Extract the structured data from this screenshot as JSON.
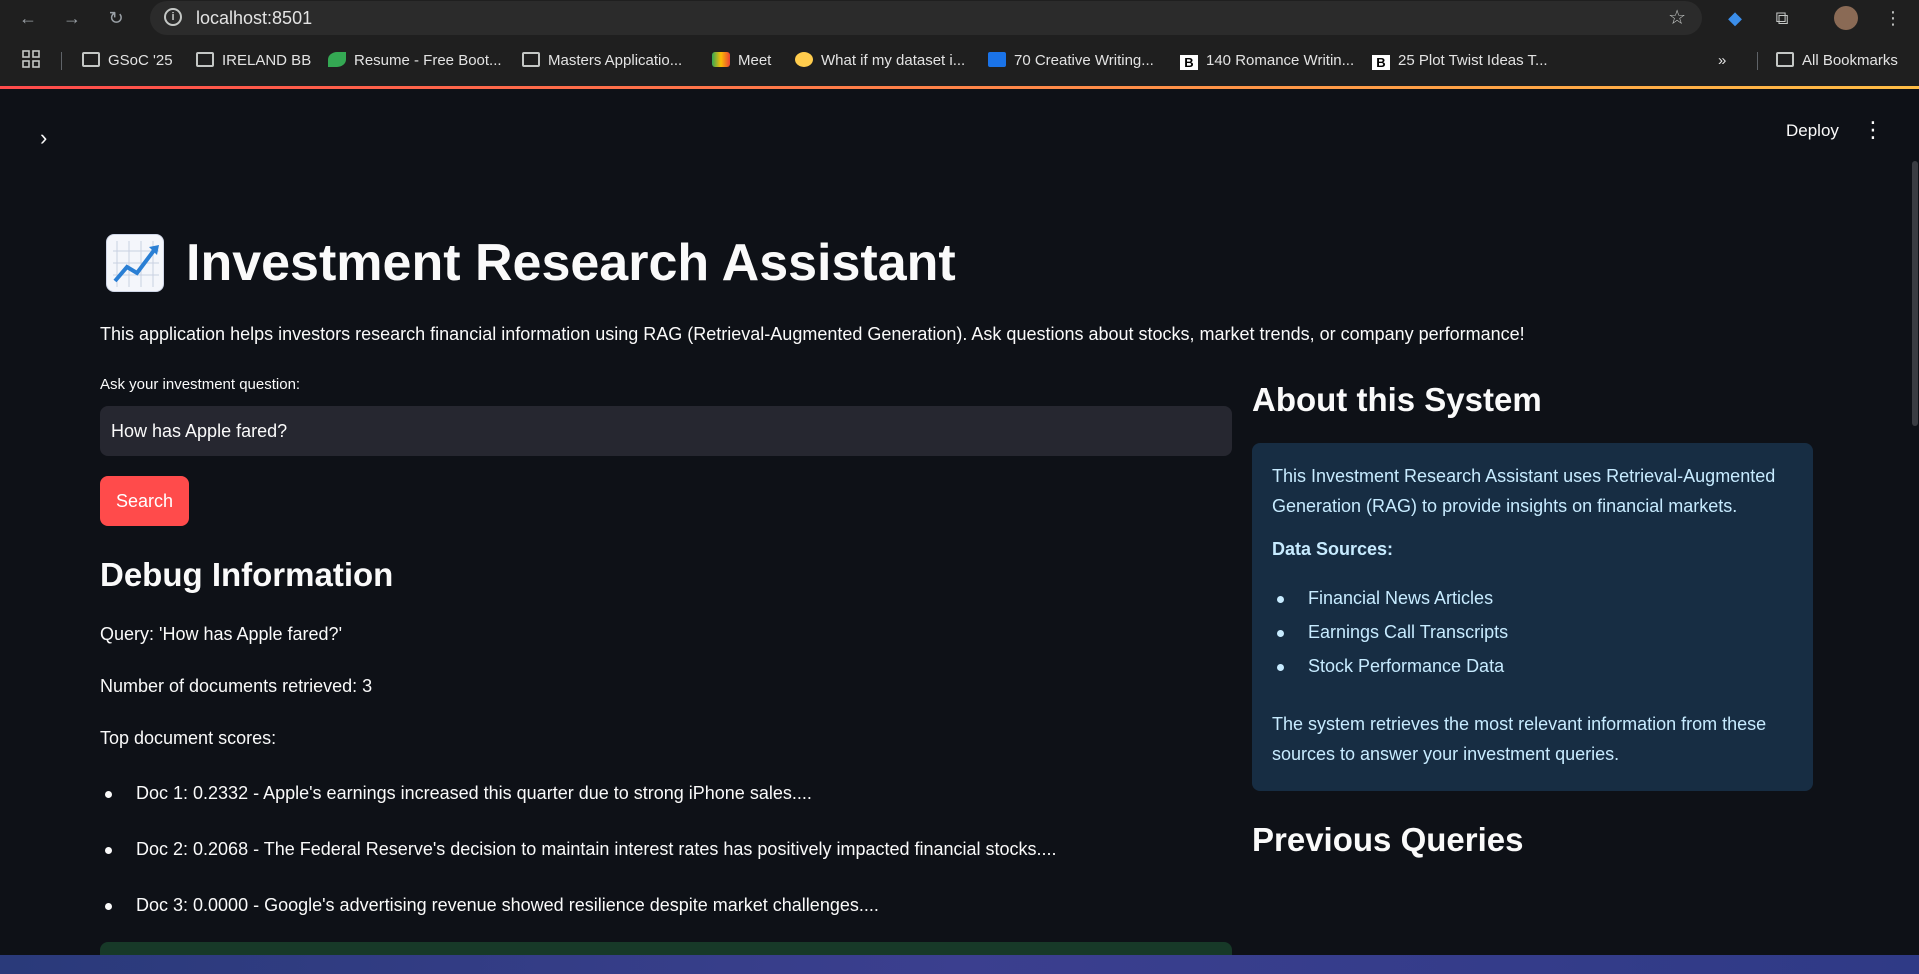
{
  "browser": {
    "url": "localhost:8501",
    "bookmarks": [
      {
        "label": "GSoC '25",
        "icon": "folder-icon"
      },
      {
        "label": "IRELAND BB",
        "icon": "folder-icon"
      },
      {
        "label": "Resume - Free Boot...",
        "icon": "leaf-icon"
      },
      {
        "label": "Masters Applicatio...",
        "icon": "folder-icon"
      },
      {
        "label": "Meet",
        "icon": "meet-icon"
      },
      {
        "label": "What if my dataset i...",
        "icon": "hugging-face-icon"
      },
      {
        "label": "70 Creative Writing...",
        "icon": "tck-icon"
      },
      {
        "label": "140 Romance Writin...",
        "icon": "b-icon"
      },
      {
        "label": "25 Plot Twist Ideas T...",
        "icon": "b-icon"
      }
    ],
    "all_bookmarks": "All Bookmarks",
    "more": "»"
  },
  "header": {
    "deploy_label": "Deploy"
  },
  "main": {
    "title": "Investment Research Assistant",
    "intro": "This application helps investors research financial information using RAG (Retrieval-Augmented Generation). Ask questions about stocks, market trends, or company performance!",
    "question_label": "Ask your investment question:",
    "question_value": "How has Apple fared?",
    "search_label": "Search",
    "debug": {
      "heading": "Debug Information",
      "query": "Query: 'How has Apple fared?'",
      "num_docs": "Number of documents retrieved: 3",
      "scores_label": "Top document scores:",
      "docs": [
        "Doc 1: 0.2332 - Apple's earnings increased this quarter due to strong iPhone sales....",
        "Doc 2: 0.2068 - The Federal Reserve's decision to maintain interest rates has positively impacted financial stocks....",
        "Doc 3: 0.0000 - Google's advertising revenue showed resilience despite market challenges...."
      ]
    }
  },
  "side": {
    "about_heading": "About this System",
    "about_text": "This Investment Research Assistant uses Retrieval-Augmented Generation (RAG) to provide insights on financial markets.",
    "sources_label": "Data Sources:",
    "sources": [
      "Financial News Articles",
      "Earnings Call Transcripts",
      "Stock Performance Data"
    ],
    "closing_text": "The system retrieves the most relevant information from these sources to answer your investment queries.",
    "previous_heading": "Previous Queries"
  },
  "colors": {
    "background": "#0e1117",
    "accent": "#ff4b4b",
    "info_box": "#172d43",
    "info_text": "#c7ebff"
  }
}
